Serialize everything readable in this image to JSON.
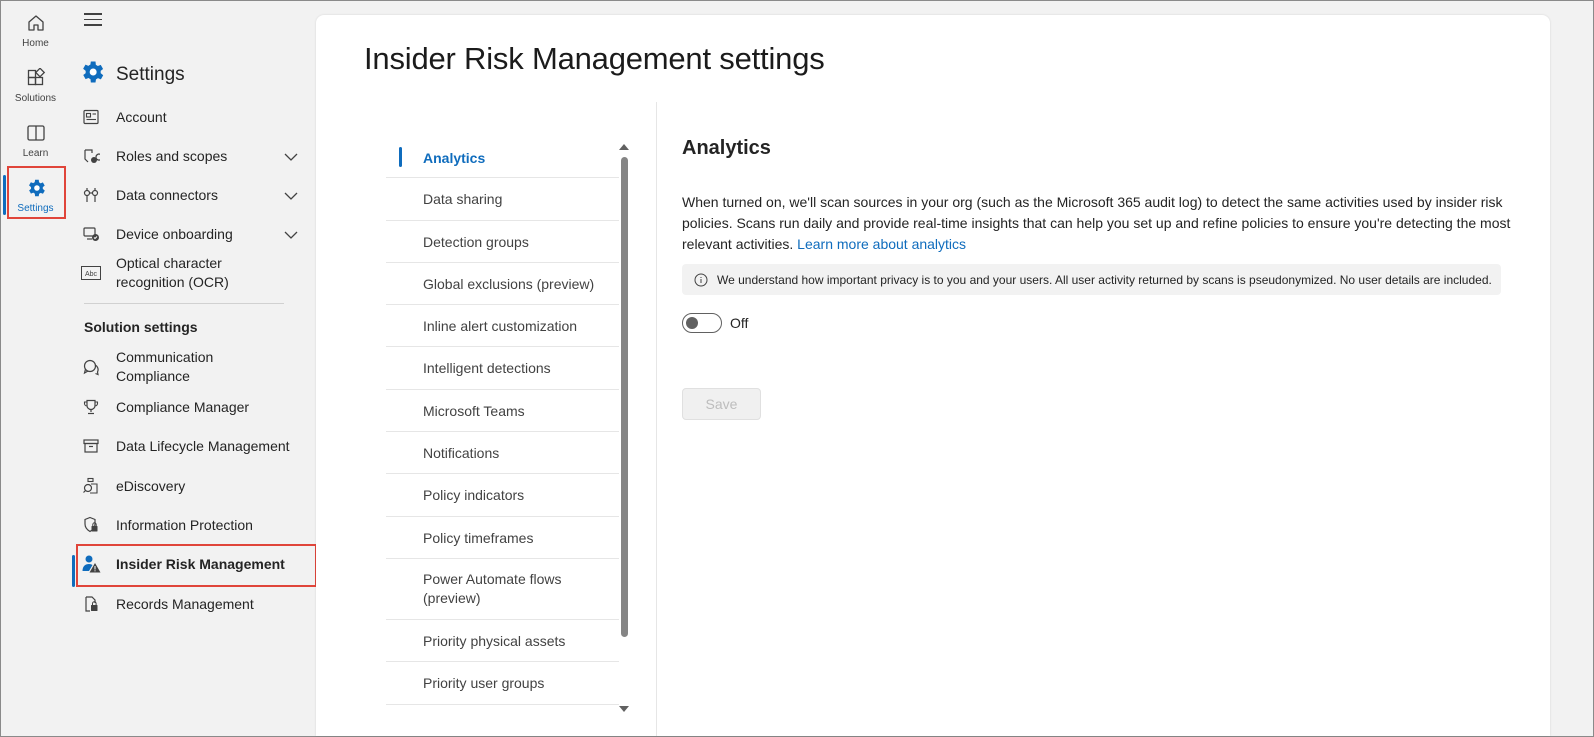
{
  "rail": {
    "items": [
      {
        "label": "Home",
        "icon": "home-icon"
      },
      {
        "label": "Solutions",
        "icon": "solutions-icon"
      },
      {
        "label": "Learn",
        "icon": "book-icon"
      },
      {
        "label": "Settings",
        "icon": "gear-icon"
      }
    ]
  },
  "nav": {
    "title": "Settings",
    "items": [
      {
        "label": "Account",
        "icon": "account-card-icon"
      },
      {
        "label": "Roles and scopes",
        "icon": "roles-icon"
      },
      {
        "label": "Data connectors",
        "icon": "plug-icon"
      },
      {
        "label": "Device onboarding",
        "icon": "device-icon"
      },
      {
        "label": "Optical character recognition (OCR)",
        "icon": "ocr-icon"
      }
    ],
    "section_label": "Solution settings",
    "solution_items": [
      {
        "label": "Communication Compliance",
        "icon": "chat-icon"
      },
      {
        "label": "Compliance Manager",
        "icon": "trophy-icon"
      },
      {
        "label": "Data Lifecycle Management",
        "icon": "archive-icon"
      },
      {
        "label": "eDiscovery",
        "icon": "discovery-icon"
      },
      {
        "label": "Information Protection",
        "icon": "shield-lock-icon"
      },
      {
        "label": "Insider Risk Management",
        "icon": "person-warning-icon"
      },
      {
        "label": "Records Management",
        "icon": "records-lock-icon"
      }
    ]
  },
  "main": {
    "title": "Insider Risk Management settings",
    "subnav": [
      "Analytics",
      "Data sharing",
      "Detection groups",
      "Global exclusions (preview)",
      "Inline alert customization",
      "Intelligent detections",
      "Microsoft Teams",
      "Notifications",
      "Policy indicators",
      "Policy timeframes",
      "Power Automate flows (preview)",
      "Priority physical assets",
      "Priority user groups"
    ],
    "section_title": "Analytics",
    "description": "When turned on, we'll scan sources in your org (such as the Microsoft 365 audit log) to detect the same activities used by insider risk policies. Scans run daily and provide real-time insights that can help you set up and refine policies to ensure you're detecting the most relevant activities.",
    "learn_more": "Learn more about analytics",
    "info_text": "We understand how important privacy is to you and your users. All user activity returned by scans is pseudonymized. No user details are included.",
    "toggle_label": "Off",
    "save_label": "Save"
  },
  "colors": {
    "accent": "#0f6cbd",
    "highlight_box": "#e0453a"
  }
}
